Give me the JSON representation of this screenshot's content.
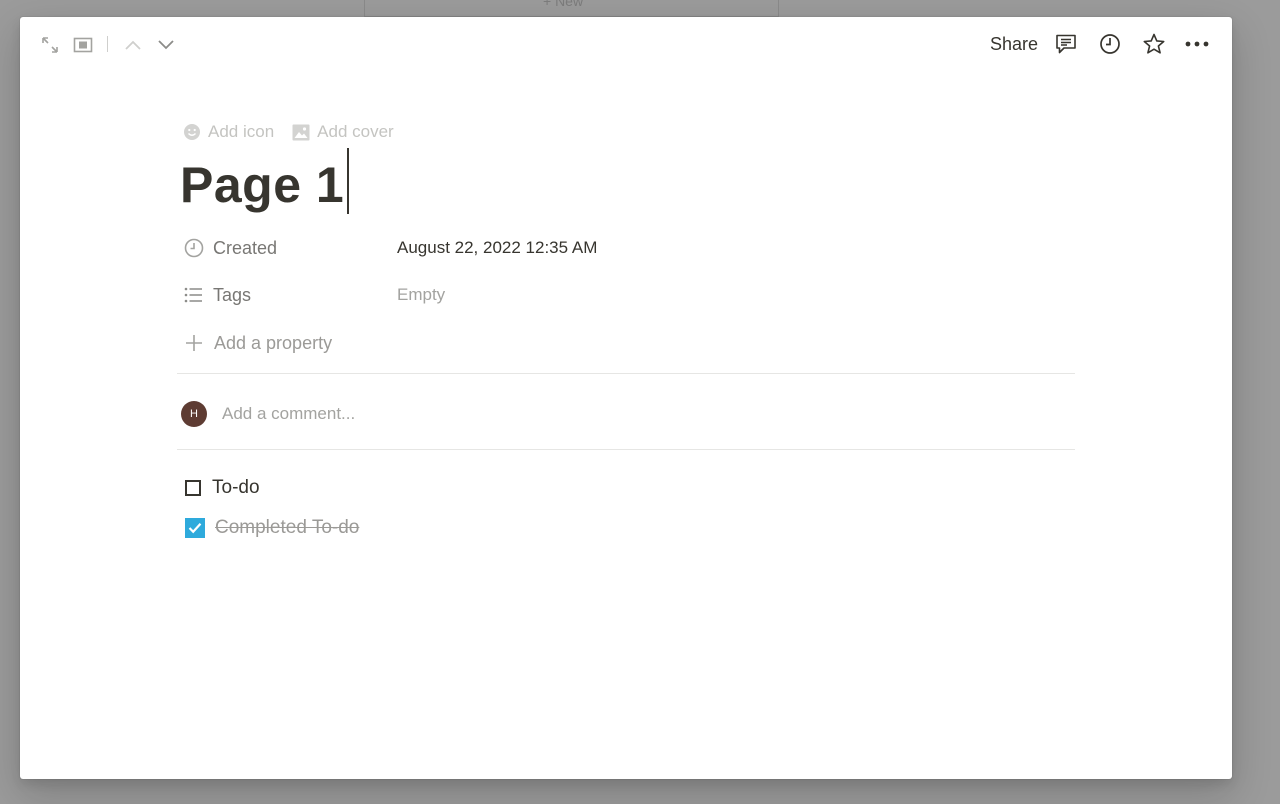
{
  "background": {
    "fragment_text": "+ New"
  },
  "topbar": {
    "share_label": "Share",
    "icons": [
      "expand-icon",
      "center-peek-icon",
      "chevron-up-icon",
      "chevron-down-icon",
      "comment-icon",
      "history-icon",
      "star-icon",
      "more-icon"
    ]
  },
  "page": {
    "add_icon_label": "Add icon",
    "add_cover_label": "Add cover",
    "title": "Page 1",
    "properties": [
      {
        "icon": "clock-icon",
        "label": "Created",
        "value": "August 22, 2022 12:35 AM"
      },
      {
        "icon": "list-icon",
        "label": "Tags",
        "value": "Empty"
      }
    ],
    "add_property_label": "Add a property",
    "comment": {
      "avatar_initial": "H",
      "placeholder": "Add a comment..."
    },
    "todos": [
      {
        "text": "To-do",
        "checked": false
      },
      {
        "text": "Completed To-do",
        "checked": true
      }
    ]
  },
  "colors": {
    "accent_checkbox": "#2eaadc",
    "avatar": "#5e3c33",
    "text": "#37352f",
    "overlay": "#9b9b9b"
  }
}
